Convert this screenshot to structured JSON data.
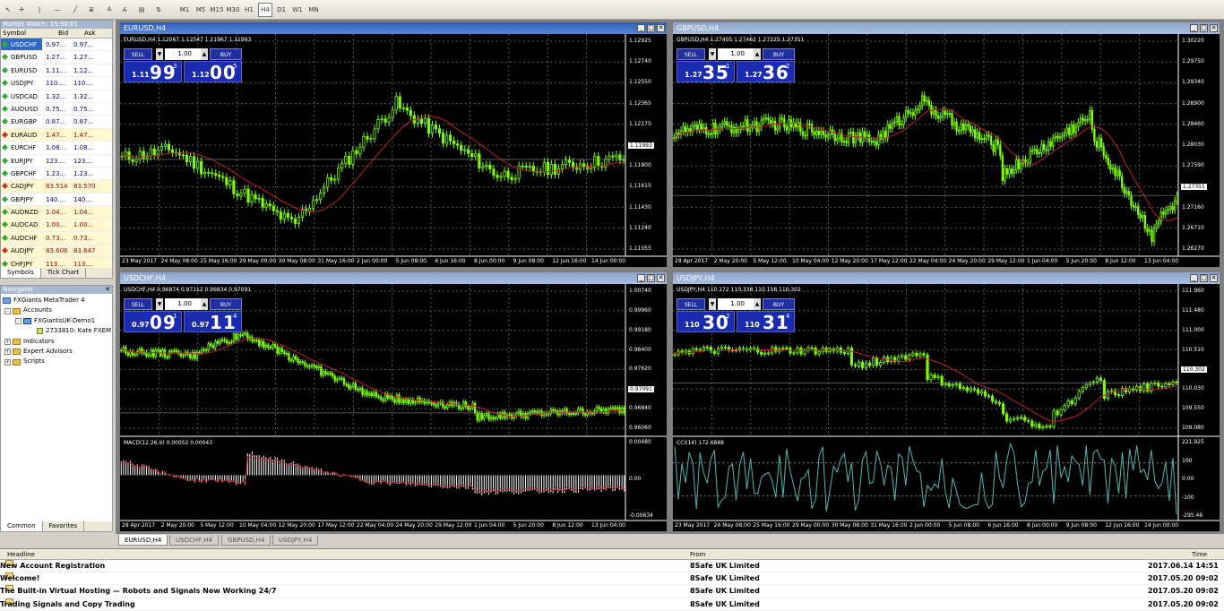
{
  "toolbar": {
    "timeframes": [
      "M1",
      "M5",
      "M15",
      "M30",
      "H1",
      "H4",
      "D1",
      "W1",
      "MN"
    ],
    "selected": "H4",
    "text_tool": "A"
  },
  "market_watch": {
    "title": "Market Watch: 15:50:01",
    "headers": [
      "Symbol",
      "Bid",
      "Ask"
    ],
    "rows": [
      {
        "symbol": "USDCHF",
        "bid": "0.97...",
        "ask": "0.97..."
      },
      {
        "symbol": "GBPUSD",
        "bid": "1.27...",
        "ask": "1.27..."
      },
      {
        "symbol": "EURUSD",
        "bid": "1.11...",
        "ask": "1.12..."
      },
      {
        "symbol": "USDJPY",
        "bid": "110....",
        "ask": "110...."
      },
      {
        "symbol": "USDCAD",
        "bid": "1.32...",
        "ask": "1.32..."
      },
      {
        "symbol": "AUDUSD",
        "bid": "0.75...",
        "ask": "0.75..."
      },
      {
        "symbol": "EURGBP",
        "bid": "0.87...",
        "ask": "0.87..."
      },
      {
        "symbol": "EURAUD",
        "bid": "1.47...",
        "ask": "1.47..."
      },
      {
        "symbol": "EURCHF",
        "bid": "1.08...",
        "ask": "1.08..."
      },
      {
        "symbol": "EURJPY",
        "bid": "123....",
        "ask": "123...."
      },
      {
        "symbol": "GBPCHF",
        "bid": "1.23...",
        "ask": "1.23..."
      },
      {
        "symbol": "CADJPY",
        "bid": "83.514",
        "ask": "83.570"
      },
      {
        "symbol": "GBPJPY",
        "bid": "140....",
        "ask": "140...."
      },
      {
        "symbol": "AUDNZD",
        "bid": "1.04...",
        "ask": "1.04..."
      },
      {
        "symbol": "AUDCAD",
        "bid": "1.00...",
        "ask": "1.00..."
      },
      {
        "symbol": "AUDCHF",
        "bid": "0.73...",
        "ask": "0.73..."
      },
      {
        "symbol": "AUDJPY",
        "bid": "83.606",
        "ask": "83.647"
      },
      {
        "symbol": "CHFJPY",
        "bid": "113....",
        "ask": "113...."
      }
    ],
    "tabs": [
      "Symbols",
      "Tick Chart"
    ]
  },
  "navigator": {
    "title": "Navigator",
    "items": [
      "FXGiants MetaTrader 4",
      "Accounts",
      "FXGiantsUK-Demo1",
      "2733810: Kate FXEM",
      "Indicators",
      "Expert Advisors",
      "Scripts"
    ],
    "tabs": [
      "Common",
      "Favorites"
    ]
  },
  "charts": [
    {
      "title": "EURUSD,H4",
      "ohlc": "EURUSD,H4  1.12067 1.12547 1.11967 1.11993",
      "sell_label": "SELL",
      "buy_label": "BUY",
      "lot": "1.00",
      "sell_small": "1.11",
      "sell_big": "99",
      "sell_sup": "3",
      "buy_small": "1.12",
      "buy_big": "00",
      "buy_sup": "5",
      "yticks": [
        "1.12925",
        "1.12740",
        "1.12550",
        "1.12365",
        "1.12175",
        "1.11993",
        "1.11800",
        "1.11615",
        "1.11430",
        "1.11240",
        "1.11055"
      ],
      "price_tag": "1.11993",
      "xticks": [
        "23 May 2017",
        "24 May 08:00",
        "25 May 16:00",
        "29 May 00:00",
        "30 May 08:00",
        "31 May 16:00",
        "2 Jun 00:00",
        "5 Jun 08:00",
        "6 Jun 16:00",
        "8 Jun 00:00",
        "9 Jun 08:00",
        "12 Jun 16:00",
        "14 Jun 00:00"
      ]
    },
    {
      "title": "GBPUSD,H4",
      "ohlc": "GBPUSD,H4  1.27405 1.27462 1.27225 1.27351",
      "sell_label": "SELL",
      "buy_label": "BUY",
      "lot": "1.00",
      "sell_small": "1.27",
      "sell_big": "35",
      "sell_sup": "1",
      "buy_small": "1.27",
      "buy_big": "36",
      "buy_sup": "2",
      "yticks": [
        "1.30220",
        "1.29750",
        "1.29340",
        "1.28900",
        "1.28460",
        "1.28030",
        "1.27590",
        "1.27351",
        "1.27160",
        "1.26710",
        "1.26270"
      ],
      "price_tag": "1.27351",
      "xticks": [
        "28 Apr 2017",
        "2 May 20:00",
        "5 May 12:00",
        "10 May 04:00",
        "12 May 20:00",
        "17 May 12:00",
        "22 May 04:00",
        "24 May 20:00",
        "29 May 12:00",
        "1 Jun 04:00",
        "5 Jun 20:00",
        "8 Jun 12:00",
        "13 Jun 04:00"
      ]
    },
    {
      "title": "USDCHF,H4",
      "ohlc": "USDCHF,H4  0.96874 0.97112 0.96834 0.97091",
      "sell_label": "SELL",
      "buy_label": "BUY",
      "lot": "1.00",
      "sell_small": "0.97",
      "sell_big": "09",
      "sell_sup": "1",
      "buy_small": "0.97",
      "buy_big": "11",
      "buy_sup": "4",
      "yticks": [
        "1.00740",
        "0.99960",
        "0.99180",
        "0.98400",
        "0.97620",
        "0.97091",
        "0.96840",
        "0.96060"
      ],
      "price_tag": "0.97091",
      "ind_label": "MACD(12,26,9) 0.00052 0.00043",
      "ind_ticks": [
        "0.00480",
        "0.00",
        "-0.00634"
      ],
      "xticks": [
        "28 Apr 2017",
        "2 May 20:00",
        "5 May 12:00",
        "10 May 04:00",
        "12 May 20:00",
        "17 May 12:00",
        "22 May 04:00",
        "24 May 20:00",
        "29 May 12:00",
        "1 Jun 04:00",
        "5 Jun 20:00",
        "8 Jun 12:00",
        "13 Jun 04:00"
      ]
    },
    {
      "title": "USDJPY,H4",
      "ohlc": "USDJPY,H4  110.172 110.338 110.158 110.302",
      "sell_label": "SELL",
      "buy_label": "BUY",
      "lot": "1.00",
      "sell_small": "110",
      "sell_big": "30",
      "sell_sup": "2",
      "buy_small": "110",
      "buy_big": "31",
      "buy_sup": "4",
      "yticks": [
        "111.960",
        "111.480",
        "111.000",
        "110.510",
        "110.302",
        "110.030",
        "109.550",
        "109.080"
      ],
      "price_tag": "110.302",
      "ind_label": "CCI(14) 172.6888",
      "ind_ticks": [
        "221.925",
        "100",
        "0.00",
        "-100",
        "-295.46"
      ],
      "xticks": [
        "23 May 2017",
        "24 May 08:00",
        "25 May 16:00",
        "29 May 00:00",
        "30 May 08:00",
        "31 May 16:00",
        "2 Jun 00:00",
        "5 Jun 08:00",
        "6 Jun 16:00",
        "8 Jun 00:00",
        "9 Jun 08:00",
        "12 Jun 16:00",
        "14 Jun 00:00"
      ]
    }
  ],
  "chart_tabs": [
    "EURUSD,H4",
    "USDCHF,H4",
    "GBPUSD,H4",
    "USDJPY,H4"
  ],
  "news": {
    "headers": [
      "Headline",
      "From",
      "Time"
    ],
    "rows": [
      {
        "headline": "New Account Registration",
        "from": "8Safe UK Limited",
        "time": "2017.06.14 14:51"
      },
      {
        "headline": "Welcome!",
        "from": "8Safe UK Limited",
        "time": "2017.05.20 09:02"
      },
      {
        "headline": "The Built-in Virtual Hosting — Robots and Signals Now Working 24/7",
        "from": "8Safe UK Limited",
        "time": "2017.05.20 09:02"
      },
      {
        "headline": "Trading Signals and Copy Trading",
        "from": "8Safe UK Limited",
        "time": "2017.05.20 09:02"
      }
    ]
  },
  "colors": {
    "candle": "#7cfc00",
    "ma": "#c0202c",
    "grid": "#5a5a5a",
    "cci": "#4fb8b0",
    "macd_hist": "#ffffff",
    "macd_signal": "#c0202c"
  }
}
